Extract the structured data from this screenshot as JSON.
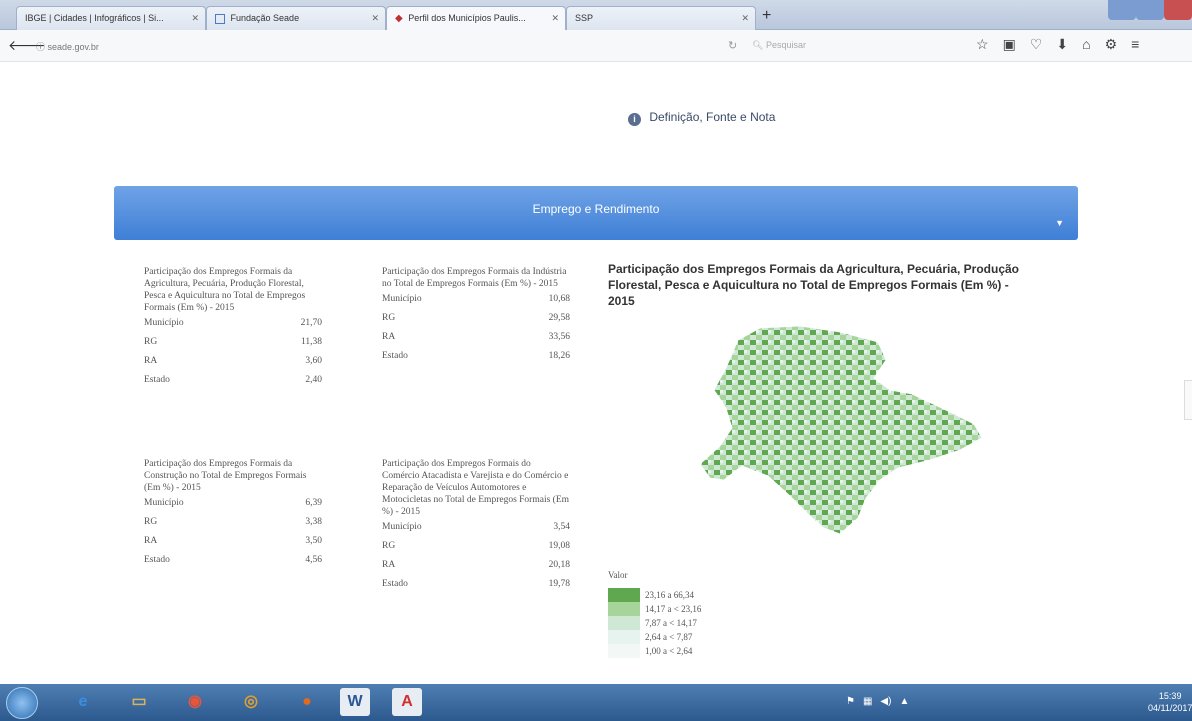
{
  "browser": {
    "tabs": [
      {
        "label": "IBGE | Cidades | Infográficos | Si..."
      },
      {
        "label": "Fundação Seade"
      },
      {
        "label": "Perfil dos Municípios Paulis..."
      },
      {
        "label": "SSP"
      }
    ],
    "url": "seade.gov.br",
    "search_placeholder": "Pesquisar"
  },
  "page": {
    "definition_link": "Definição, Fonte e Nota",
    "section_title": "Emprego e Rendimento",
    "panels": [
      {
        "title": "Participação dos Empregos Formais da Agricultura, Pecuária, Produção Florestal, Pesca e Aquicultura no Total de Empregos Formais (Em %) - 2015",
        "rows": [
          {
            "label": "Município",
            "value": "21,70"
          },
          {
            "label": "RG",
            "value": "11,38"
          },
          {
            "label": "RA",
            "value": "3,60"
          },
          {
            "label": "Estado",
            "value": "2,40"
          }
        ]
      },
      {
        "title": "Participação dos Empregos Formais da Indústria no Total de Empregos Formais (Em %) - 2015",
        "rows": [
          {
            "label": "Município",
            "value": "10,68"
          },
          {
            "label": "RG",
            "value": "29,58"
          },
          {
            "label": "RA",
            "value": "33,56"
          },
          {
            "label": "Estado",
            "value": "18,26"
          }
        ]
      },
      {
        "title": "Participação dos Empregos Formais da Construção no Total de Empregos Formais (Em %) - 2015",
        "rows": [
          {
            "label": "Município",
            "value": "6,39"
          },
          {
            "label": "RG",
            "value": "3,38"
          },
          {
            "label": "RA",
            "value": "3,50"
          },
          {
            "label": "Estado",
            "value": "4,56"
          }
        ]
      },
      {
        "title": "Participação dos Empregos Formais do Comércio Atacadista e Varejista e do Comércio e Reparação de Veículos Automotores e Motocicletas no Total de Empregos Formais (Em %) - 2015",
        "rows": [
          {
            "label": "Município",
            "value": "3,54"
          },
          {
            "label": "RG",
            "value": "19,08"
          },
          {
            "label": "RA",
            "value": "20,18"
          },
          {
            "label": "Estado",
            "value": "19,78"
          }
        ]
      }
    ],
    "map": {
      "title": "Participação dos Empregos Formais da Agricultura, Pecuária, Produção Florestal, Pesca e Aquicultura no Total de Empregos Formais (Em %) - 2015",
      "legend_title": "Valor",
      "legend": [
        {
          "label": "23,16 a 66,34",
          "color": "#5fa84f"
        },
        {
          "label": "14,17 a < 23,16",
          "color": "#a6d49a"
        },
        {
          "label": "7,87 a < 14,17",
          "color": "#cfe8d6"
        },
        {
          "label": "2,64 a < 7,87",
          "color": "#e7f3ee"
        },
        {
          "label": "1,00 a < 2,64",
          "color": "#f3f8f6"
        }
      ]
    }
  },
  "taskbar": {
    "apps": [
      {
        "name": "Internet Explorer",
        "glyph": "e"
      },
      {
        "name": "Windows Explorer",
        "glyph": "▭"
      },
      {
        "name": "Media Player",
        "glyph": "◉"
      },
      {
        "name": "Chrome",
        "glyph": "◎"
      },
      {
        "name": "Firefox",
        "glyph": "●"
      },
      {
        "name": "Word",
        "glyph": "W"
      },
      {
        "name": "Acrobat",
        "glyph": "A"
      }
    ],
    "time": "15:39",
    "date": "04/11/2017"
  }
}
